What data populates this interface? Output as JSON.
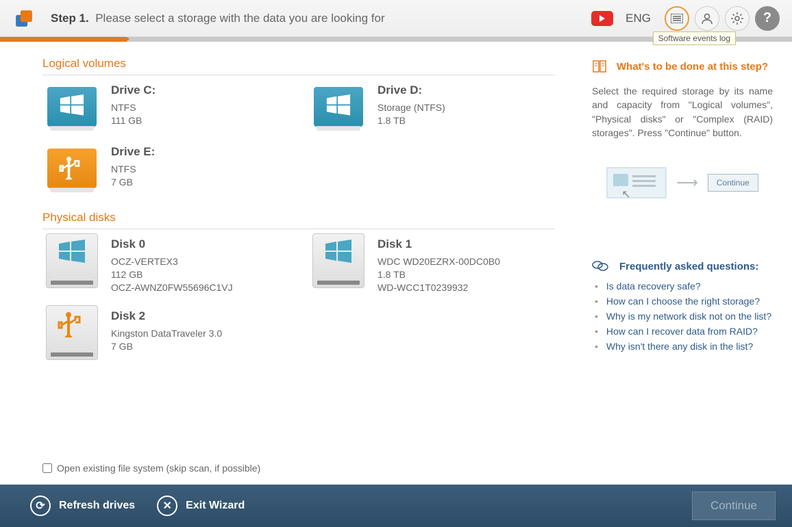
{
  "header": {
    "step_prefix": "Step 1.",
    "step_text": "Please select a storage with the data you are looking for",
    "language": "ENG",
    "tooltip": "Software events log"
  },
  "sections": {
    "logical_title": "Logical volumes",
    "physical_title": "Physical disks"
  },
  "volumes": [
    {
      "name": "Drive C:",
      "fs": "NTFS",
      "size": "111 GB",
      "kind": "win"
    },
    {
      "name": "Drive D:",
      "fs": "Storage (NTFS)",
      "size": "1.8 TB",
      "kind": "win"
    },
    {
      "name": "Drive E:",
      "fs": "NTFS",
      "size": "7 GB",
      "kind": "usb"
    }
  ],
  "disks": [
    {
      "name": "Disk 0",
      "model": "OCZ-VERTEX3",
      "size": "112 GB",
      "serial": "OCZ-AWNZ0FW55696C1VJ",
      "kind": "win"
    },
    {
      "name": "Disk 1",
      "model": "WDC WD20EZRX-00DC0B0",
      "size": "1.8 TB",
      "serial": "WD-WCC1T0239932",
      "kind": "win"
    },
    {
      "name": "Disk 2",
      "model": "Kingston DataTraveler 3.0",
      "size": "7 GB",
      "serial": "",
      "kind": "usb"
    }
  ],
  "help": {
    "title": "What's to be done at this step?",
    "text": "Select the required storage by its name and capacity from \"Logical volumes\", \"Physical disks\" or \"Complex (RAID) storages\". Press \"Continue\" button.",
    "illus_btn": "Continue"
  },
  "faq": {
    "title": "Frequently asked questions:",
    "items": [
      "Is data recovery safe?",
      "How can I choose the right storage?",
      "Why is my network disk not on the list?",
      "How can I recover data from RAID?",
      "Why isn't there any disk in the list?"
    ]
  },
  "checkbox_label": "Open existing file system (skip scan, if possible)",
  "footer": {
    "refresh": "Refresh drives",
    "exit": "Exit Wizard",
    "continue": "Continue"
  }
}
